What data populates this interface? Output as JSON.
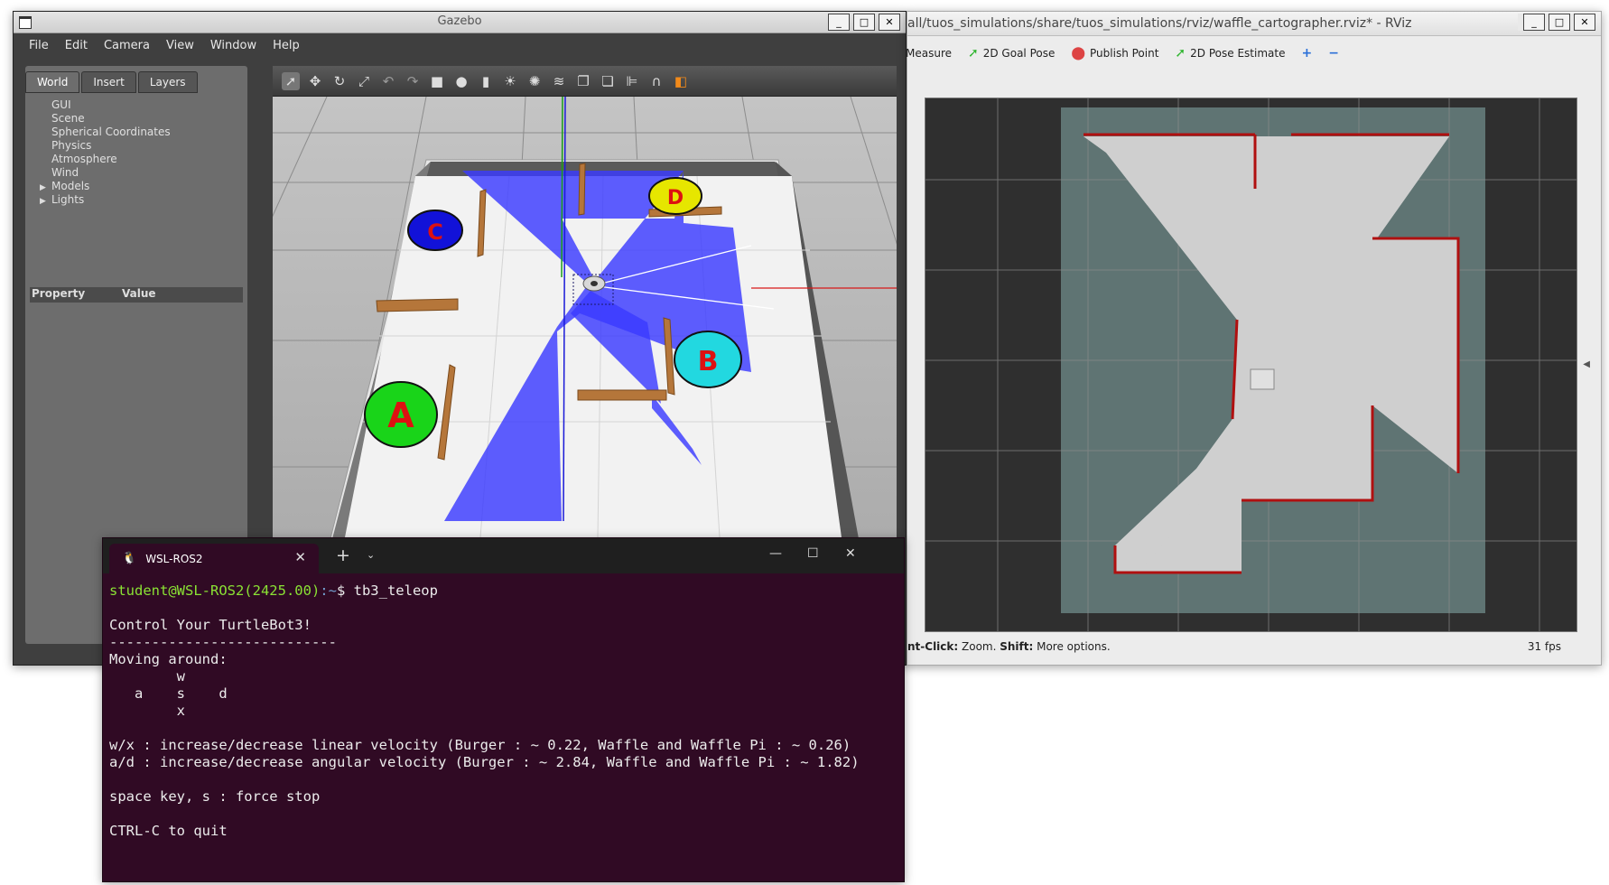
{
  "gazebo": {
    "title": "Gazebo",
    "menu": [
      "File",
      "Edit",
      "Camera",
      "View",
      "Window",
      "Help"
    ],
    "tabs": [
      "World",
      "Insert",
      "Layers"
    ],
    "tree": [
      {
        "label": "GUI",
        "expandable": false
      },
      {
        "label": "Scene",
        "expandable": false
      },
      {
        "label": "Spherical Coordinates",
        "expandable": false
      },
      {
        "label": "Physics",
        "expandable": false
      },
      {
        "label": "Atmosphere",
        "expandable": false
      },
      {
        "label": "Wind",
        "expandable": false
      },
      {
        "label": "Models",
        "expandable": true
      },
      {
        "label": "Lights",
        "expandable": true
      }
    ],
    "property_header": "Property",
    "value_header": "Value",
    "markers": {
      "a": "A",
      "b": "B",
      "c": "C",
      "d": "D"
    },
    "colors": {
      "a": "#19d419",
      "b": "#22d8e0",
      "c": "#1212d8",
      "d": "#e6e600",
      "label": "#dd1111",
      "laser": "#3a3aff"
    }
  },
  "rviz": {
    "title": "all/tuos_simulations/share/tuos_simulations/rviz/waffle_cartographer.rviz* - RViz",
    "tools": [
      {
        "label": "Measure",
        "icon": "ruler-icon"
      },
      {
        "label": "2D Goal Pose",
        "icon": "green-arrow-icon"
      },
      {
        "label": "Publish Point",
        "icon": "map-pin-icon"
      },
      {
        "label": "2D Pose Estimate",
        "icon": "green-arrow-icon"
      }
    ],
    "status_prefix": "nt-Click:",
    "status_zoom": " Zoom. ",
    "status_shift": "Shift:",
    "status_more": " More options.",
    "fps": "31 fps"
  },
  "terminal": {
    "tab_title": "WSL-ROS2",
    "prompt_user": "student@WSL-ROS2(2425.00)",
    "prompt_path": ":~",
    "command": "$ tb3_teleop",
    "lines": [
      "",
      "Control Your TurtleBot3!",
      "---------------------------",
      "Moving around:",
      "        w",
      "   a    s    d",
      "        x",
      "",
      "w/x : increase/decrease linear velocity (Burger : ~ 0.22, Waffle and Waffle Pi : ~ 0.26)",
      "a/d : increase/decrease angular velocity (Burger : ~ 2.84, Waffle and Waffle Pi : ~ 1.82)",
      "",
      "space key, s : force stop",
      "",
      "CTRL-C to quit"
    ]
  }
}
